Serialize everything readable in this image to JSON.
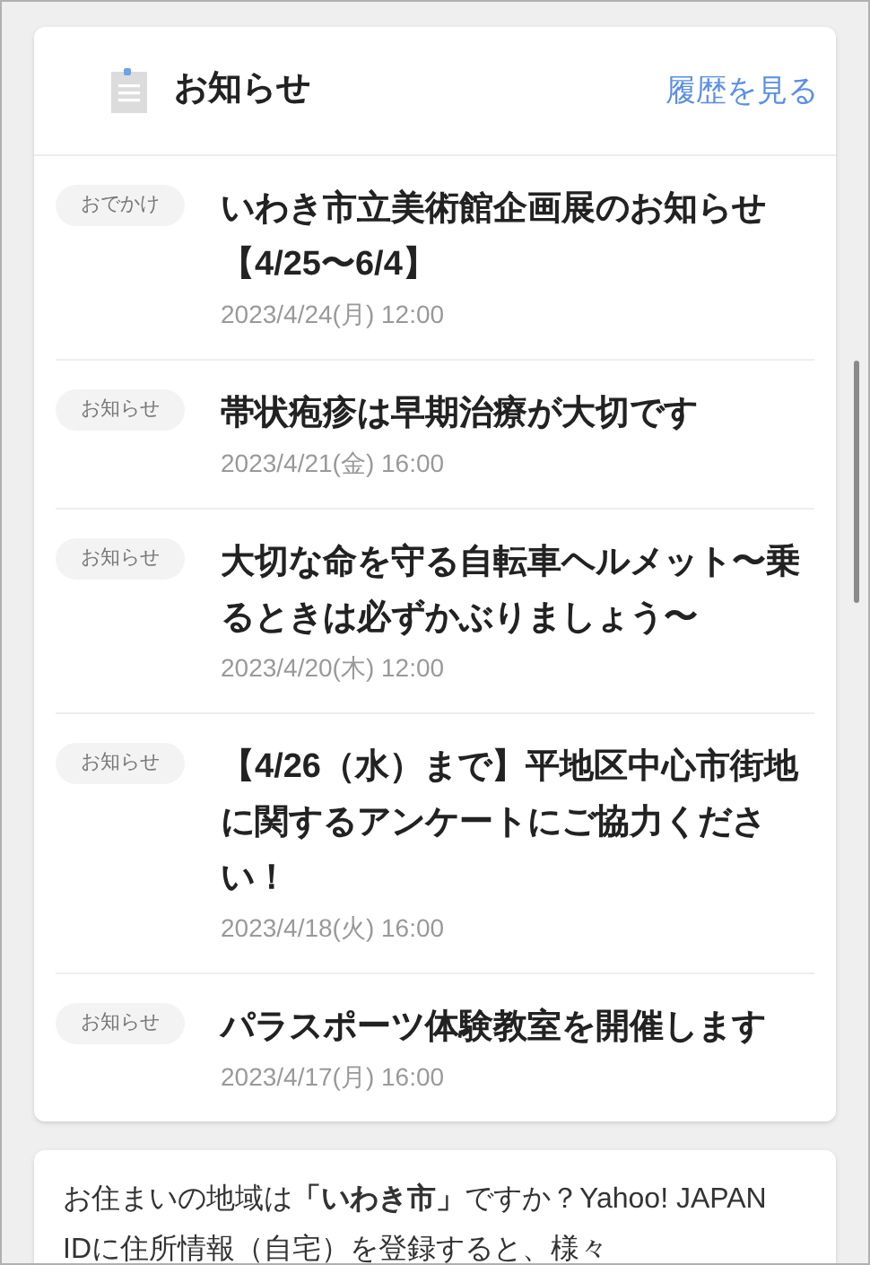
{
  "header": {
    "title": "お知らせ",
    "history_link": "履歴を見る"
  },
  "notices": [
    {
      "category": "おでかけ",
      "title": "いわき市立美術館企画展のお知らせ【4/25〜6/4】",
      "date": "2023/4/24(月) 12:00"
    },
    {
      "category": "お知らせ",
      "title": "帯状疱疹は早期治療が大切です",
      "date": "2023/4/21(金) 16:00"
    },
    {
      "category": "お知らせ",
      "title": "大切な命を守る自転車ヘルメット〜乗るときは必ずかぶりましょう〜",
      "date": "2023/4/20(木) 12:00"
    },
    {
      "category": "お知らせ",
      "title": "【4/26（水）まで】平地区中心市街地に関するアンケートにご協力ください！",
      "date": "2023/4/18(火) 16:00"
    },
    {
      "category": "お知らせ",
      "title": "パラスポーツ体験教室を開催します",
      "date": "2023/4/17(月) 16:00"
    }
  ],
  "region_card": {
    "text": "お住まいの地域は**「いわき市」**ですか？Yahoo! JAPAN IDに住所情報（自宅）を登録すると、様々"
  }
}
